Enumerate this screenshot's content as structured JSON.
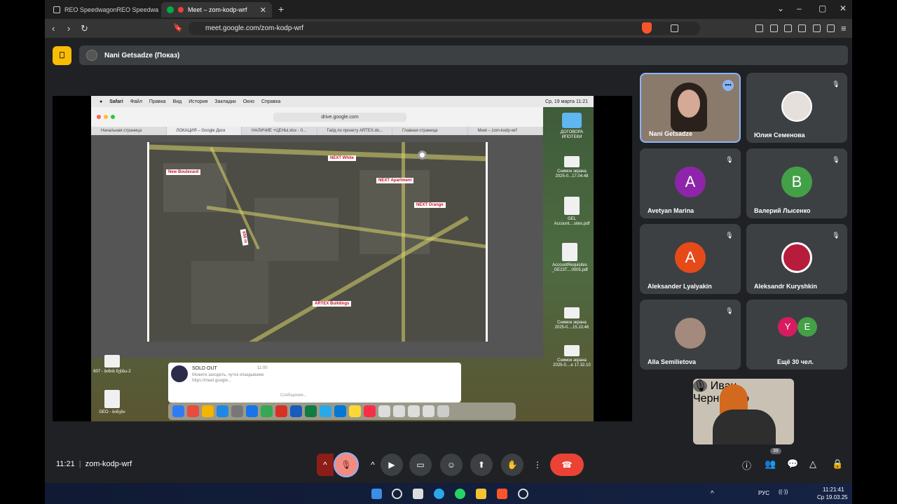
{
  "browser": {
    "tabs": [
      {
        "label": "REO SpeedwagonREO Speedwagon",
        "active": false
      },
      {
        "label": "Meet – zom-kodp-wrf",
        "active": true
      }
    ],
    "new_tab": "+",
    "url": "meet.google.com/zom-kodp-wrf",
    "window_controls": {
      "dropdown": "⌄",
      "minimize": "–",
      "maximize": "▢",
      "close": "✕"
    },
    "nav": {
      "back": "‹",
      "forward": "›",
      "reload": "↻"
    }
  },
  "meet": {
    "logo_glyph": "⎕",
    "presenter_label": "Nani Getsadze (Показ)",
    "time": "11:21",
    "meeting_code": "zom-kodp-wrf",
    "participants_badge": "39",
    "colors": {
      "accent": "#8ab4f8",
      "end_call": "#ea4335",
      "tile_bg": "#3c4043",
      "page_bg": "#202124"
    }
  },
  "shared_screen": {
    "mac_menu": [
      "Safari",
      "Файл",
      "Правка",
      "Вид",
      "История",
      "Закладки",
      "Окно",
      "Справка"
    ],
    "mac_clock": "Ср, 19 марта 11:21",
    "safari_url": "drive.google.com",
    "safari_tabs": [
      "Начальная страница",
      "ЛОКАЦИЯ – Google Диск",
      "НАЛИЧИЕ +ЦЕНЫ.xlsx - 0...",
      "Гайд по проекту ARTEX.do...",
      "Главная страница",
      "Meet – zom-kodp-wrf"
    ],
    "map_labels": [
      "New Boulevard",
      "NEXT White",
      "NEXT Apartment",
      "NEXT Orange",
      "ARTEX Buildings",
      "650 m"
    ],
    "desktop_items": [
      "ДОГОВОРА ИПОТЕКИ",
      "Снимок экрана 2025-0...17.04.48",
      "GEL Account....sites.pdf",
      "AccountRequisites _GE23T....0005.pdf",
      "Снимок экрана 2025-0....15.10.46",
      "Снимок экрана 2025-0....e 17.32.10",
      "607 - ბინის ნუსხა-2",
      "GEO - ბინები"
    ],
    "chat": {
      "title": "SOLD OUT",
      "time": "11:00",
      "preview": "Можете заходить, чуток опаздываем https://meet.google...",
      "input_placeholder": "Сообщение..."
    }
  },
  "participants": [
    {
      "name": "Nani Getsadze",
      "kind": "video",
      "highlighted": true
    },
    {
      "name": "Юлия Семенова",
      "kind": "photo",
      "muted": true
    },
    {
      "name": "Avetyan Marina",
      "kind": "letter",
      "letter": "A",
      "color": "#8e24aa",
      "muted": true
    },
    {
      "name": "Валерий Лысенко",
      "kind": "letter",
      "letter": "B",
      "color": "#43a047",
      "muted": true
    },
    {
      "name": "Aleksander Lyalyakin",
      "kind": "letter",
      "letter": "A",
      "color": "#e64a19",
      "muted": true
    },
    {
      "name": "Aleksandr Kuryshkin",
      "kind": "photo",
      "muted": true
    },
    {
      "name": "Alla Semilietova",
      "kind": "photo",
      "muted": true
    },
    {
      "name": "Ещё 30 чел.",
      "kind": "more",
      "letters": [
        "Y",
        "E"
      ],
      "colors": [
        "#d81b60",
        "#43a047"
      ]
    }
  ],
  "self_view": {
    "name": "Иван Черниенко"
  },
  "taskbar": {
    "lang": "РУС",
    "time": "11:21:41",
    "date": "Ср 19.03.25"
  }
}
